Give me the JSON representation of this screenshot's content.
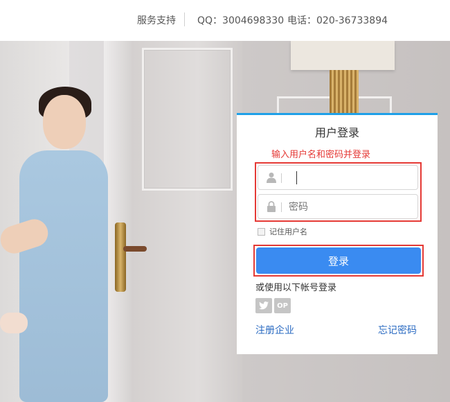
{
  "topbar": {
    "service": "服务支持",
    "qq": "QQ：3004698330",
    "phone": "电话：020-36733894"
  },
  "login": {
    "title": "用户登录",
    "hint": "输入用户名和密码并登录",
    "username": {
      "value": "",
      "placeholder": ""
    },
    "password": {
      "value": "",
      "placeholder": "密码"
    },
    "remember_label": "记住用户名",
    "submit_label": "登录",
    "alt_login_label": "或使用以下帐号登录",
    "social": [
      {
        "name": "twitter-icon",
        "glyph": "🐦"
      },
      {
        "name": "op-icon",
        "glyph": "OP"
      }
    ],
    "register_label": "注册企业",
    "forgot_label": "忘记密码"
  },
  "colors": {
    "accent": "#3a8bf1",
    "card_top_border": "#1fa0e8",
    "hint_red": "#e53935",
    "link_blue": "#2b6bc2"
  }
}
